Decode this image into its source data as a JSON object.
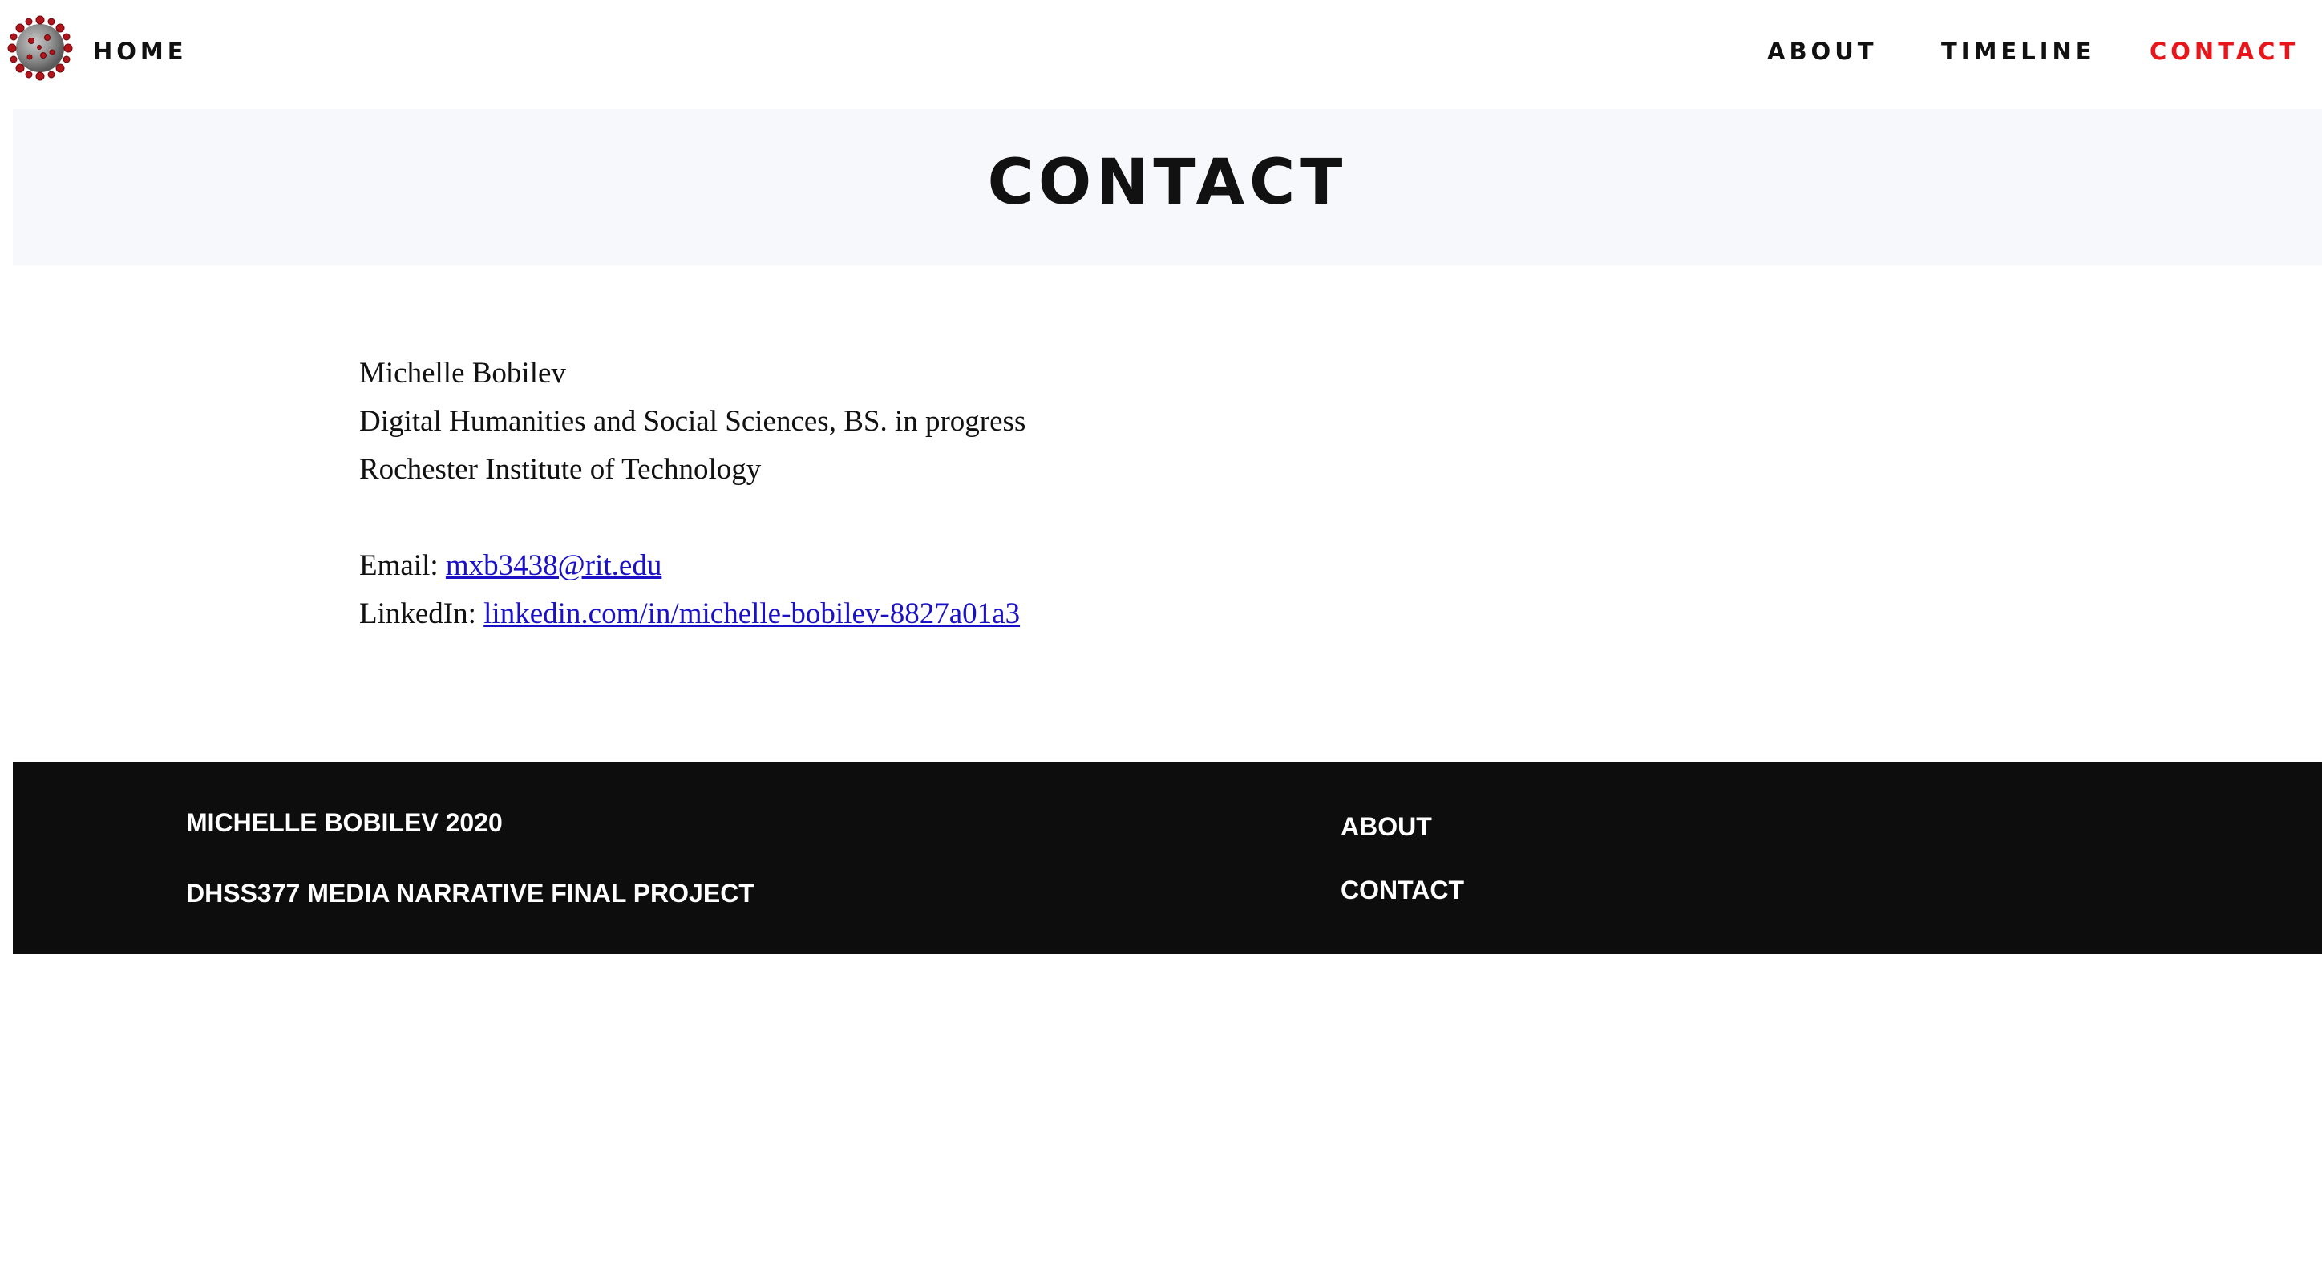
{
  "nav": {
    "logo_icon": "virus-icon",
    "home_label": "HOME",
    "items": [
      {
        "label": "ABOUT"
      },
      {
        "label": "TIMELINE"
      },
      {
        "label": "CONTACT"
      }
    ],
    "active_color": "#e8151b",
    "text_color": "#111111"
  },
  "hero": {
    "title": "CONTACT",
    "background": "#f7f8fc"
  },
  "contact": {
    "name": "Michelle Bobilev",
    "degree": "Digital Humanities and Social Sciences, BS. in progress",
    "school": "Rochester Institute of Technology",
    "email_label": "Email: ",
    "email": "mxb3438@rit.edu",
    "linkedin_label": "LinkedIn: ",
    "linkedin": "linkedin.com/in/michelle-bobilev-8827a01a3",
    "link_color": "#1a10c8"
  },
  "footer": {
    "owner": "MICHELLE BOBILEV 2020",
    "project": "DHSS377 MEDIA NARRATIVE FINAL PROJECT",
    "links": [
      {
        "label": "ABOUT"
      },
      {
        "label": "CONTACT"
      }
    ],
    "background": "#0d0d0d"
  }
}
